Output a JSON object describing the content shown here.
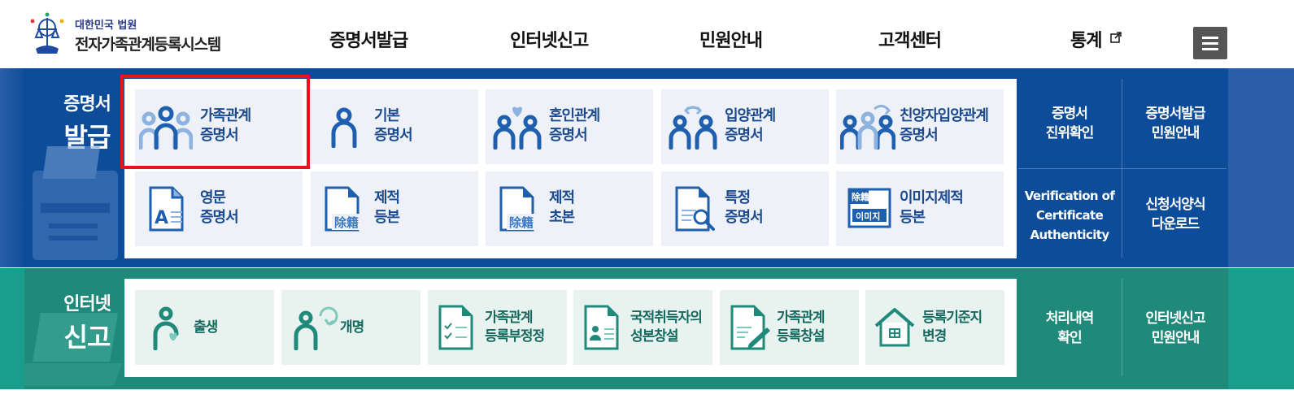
{
  "header": {
    "logo_sub": "대한민국 법원",
    "logo_main": "전자가족관계등록시스템",
    "nav": [
      "증명서발급",
      "인터넷신고",
      "민원안내",
      "고객센터",
      "통계"
    ],
    "menu_icon": "hamburger-icon",
    "external_icon": "external-link-icon"
  },
  "certificate": {
    "label_small": "증명서",
    "label_big": "발급",
    "cards": [
      {
        "line1": "가족관계",
        "line2": "증명서",
        "icon": "family-icon"
      },
      {
        "line1": "기본",
        "line2": "증명서",
        "icon": "person-icon"
      },
      {
        "line1": "혼인관계",
        "line2": "증명서",
        "icon": "marriage-icon"
      },
      {
        "line1": "입양관계",
        "line2": "증명서",
        "icon": "adoption-icon"
      },
      {
        "line1": "친양자입양관계",
        "line2": "증명서",
        "icon": "full-adoption-icon"
      },
      {
        "line1": "영문",
        "line2": "증명서",
        "icon": "english-doc-icon"
      },
      {
        "line1": "제적",
        "line2": "등본",
        "icon": "removed-register-icon"
      },
      {
        "line1": "제적",
        "line2": "초본",
        "icon": "removed-extract-icon"
      },
      {
        "line1": "특정",
        "line2": "증명서",
        "icon": "search-doc-icon"
      },
      {
        "line1": "이미지제적",
        "line2": "등본",
        "icon": "image-register-icon"
      }
    ],
    "doc_stamp": "除籍",
    "image_stamp_top": "除籍",
    "image_stamp_bottom": "이미지",
    "side_links": [
      {
        "line1": "증명서",
        "line2": "진위확인"
      },
      {
        "line1": "증명서발급",
        "line2": "민원안내"
      },
      {
        "line1": "Verification of",
        "line2": "Certificate",
        "line3": "Authenticity"
      },
      {
        "line1": "신청서양식",
        "line2": "다운로드"
      }
    ]
  },
  "internet": {
    "label_small": "인터넷",
    "label_big": "신고",
    "cards": [
      {
        "line1": "출생",
        "line2": "",
        "icon": "birth-icon"
      },
      {
        "line1": "개명",
        "line2": "",
        "icon": "rename-icon"
      },
      {
        "line1": "가족관계",
        "line2": "등록부정정",
        "icon": "checklist-doc-icon"
      },
      {
        "line1": "국적취득자의",
        "line2": "성본창설",
        "icon": "id-doc-icon"
      },
      {
        "line1": "가족관계",
        "line2": "등록창설",
        "icon": "write-doc-icon"
      },
      {
        "line1": "등록기준지",
        "line2": "변경",
        "icon": "house-icon"
      }
    ],
    "side_links": [
      {
        "line1": "처리내역",
        "line2": "확인"
      },
      {
        "line1": "인터넷신고",
        "line2": "민원안내"
      }
    ]
  },
  "colors": {
    "cert_band": "#0d4c98",
    "internet_band": "#1f8a7a",
    "highlight": "#e8141b",
    "icon_blue": "#1e5fb0",
    "icon_light_blue": "#8fb3e0",
    "icon_teal": "#1f8a7a"
  }
}
